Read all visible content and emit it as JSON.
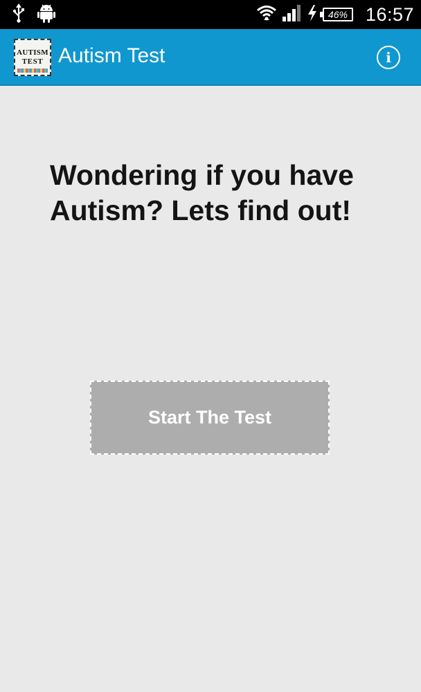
{
  "status_bar": {
    "left_icons": [
      "usb-icon",
      "android-icon"
    ],
    "right_icons": [
      "wifi-icon",
      "signal-icon",
      "charging-icon"
    ],
    "battery_level": "46%",
    "time": "16:57"
  },
  "app_bar": {
    "logo_text_line1": "AUTISM",
    "logo_text_line2": "TEST",
    "title": "Autism Test",
    "info_icon": "info-icon",
    "info_glyph": "i",
    "background_color": "#1197cf"
  },
  "main": {
    "headline": "Wondering if you have Autism? Lets find out!",
    "start_button_label": "Start The Test",
    "background_color": "#e9e9ea",
    "button_color": "#aeadae"
  }
}
